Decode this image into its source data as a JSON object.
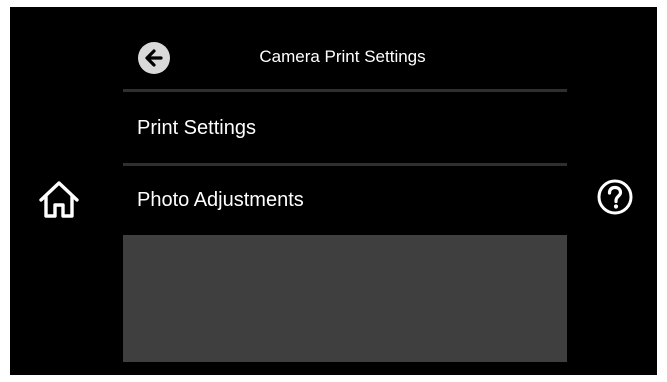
{
  "header": {
    "back_icon": "back-arrow-icon",
    "title": "Camera Print Settings"
  },
  "menu": {
    "items": [
      {
        "label": "Print Settings"
      },
      {
        "label": "Photo Adjustments"
      }
    ]
  },
  "side_buttons": {
    "home_icon": "home-icon",
    "help_icon": "help-icon"
  },
  "colors": {
    "background": "#000000",
    "text": "#ffffff",
    "divider": "#2f2f2f",
    "empty_area": "#3f3f3f",
    "back_button": "#d9d9d9"
  }
}
